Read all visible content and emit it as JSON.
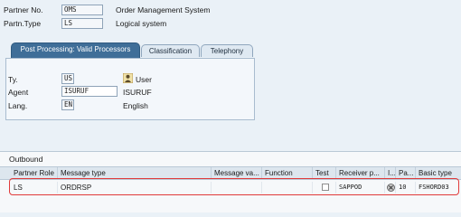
{
  "header": {
    "partner_no_label": "Partner No.",
    "partner_no_value": "OMS",
    "partner_no_desc": "Order Management System",
    "partner_type_label": "Partn.Type",
    "partner_type_value": "LS",
    "partner_type_desc": "Logical system"
  },
  "tabs": [
    {
      "label": "Post Processing: Valid Processors"
    },
    {
      "label": "Classification"
    },
    {
      "label": "Telephony"
    }
  ],
  "processor": {
    "ty_label": "Ty.",
    "ty_value": "US",
    "ty_desc": "User",
    "agent_label": "Agent",
    "agent_value": "ISURUF",
    "agent_desc": "ISURUF",
    "lang_label": "Lang.",
    "lang_value": "EN",
    "lang_desc": "English"
  },
  "outbound": {
    "title": "Outbound",
    "columns": [
      "Partner Role",
      "Message type",
      "Message va...",
      "Function",
      "Test",
      "Receiver p...",
      "I...",
      "Pa...",
      "Basic type"
    ],
    "rows": [
      {
        "partner_role": "LS",
        "message_type": "ORDRSP",
        "message_variant": "",
        "function": "",
        "test": false,
        "receiver_port": "SAPPOD",
        "indicator": "",
        "pack_size": "10",
        "basic_type": "FSHORD03"
      }
    ]
  },
  "colors": {
    "active_tab": "#3f6e98",
    "highlight": "#e03a3a",
    "background": "#eaf1f7"
  }
}
